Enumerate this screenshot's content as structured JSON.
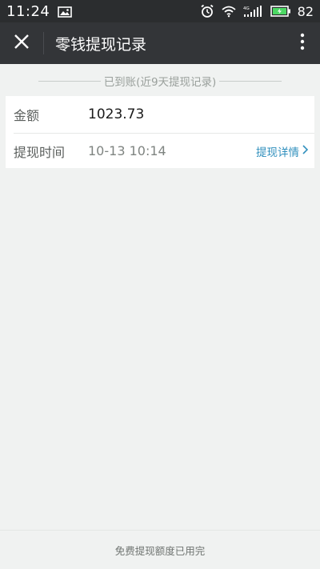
{
  "status_bar": {
    "time": "11:24",
    "battery_level": "82",
    "icons": [
      "image-icon",
      "alarm-icon",
      "wifi-icon",
      "signal-icon",
      "battery-icon"
    ]
  },
  "app_bar": {
    "title": "零钱提现记录",
    "close_icon": "close-icon",
    "more_icon": "more-vertical-icon"
  },
  "section": {
    "caption": "已到账(近9天提现记录)"
  },
  "record": {
    "amount_label": "金额",
    "amount_value": "1023.73",
    "time_label": "提现时间",
    "time_value": "10-13 10:14",
    "detail_link": "提现详情"
  },
  "footer": {
    "note": "免费提现额度已用完"
  },
  "colors": {
    "status_bar_bg": "#2b2d2f",
    "app_bar_bg": "#333538",
    "page_bg": "#f0f2f1",
    "link": "#2f8fbd",
    "battery_fill": "#4cd964"
  }
}
